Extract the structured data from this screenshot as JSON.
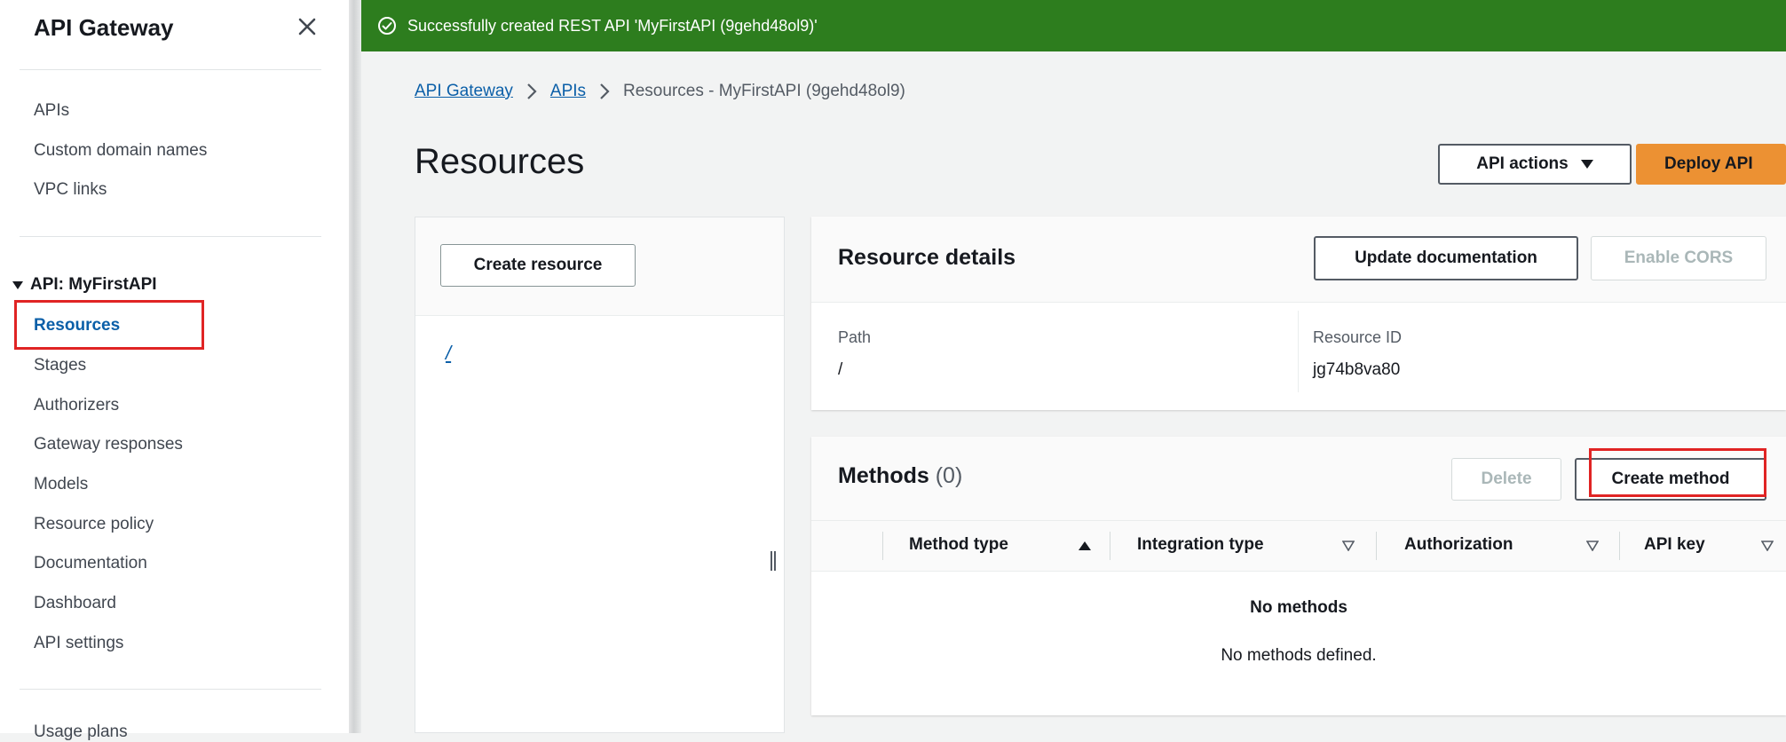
{
  "sidebar": {
    "title": "API Gateway",
    "top_links": [
      "APIs",
      "Custom domain names",
      "VPC links"
    ],
    "group_label": "API: MyFirstAPI",
    "group_items": [
      "Resources",
      "Stages",
      "Authorizers",
      "Gateway responses",
      "Models",
      "Resource policy",
      "Documentation",
      "Dashboard",
      "API settings"
    ],
    "truncated_item": "Usage plans"
  },
  "flash": {
    "message": "Successfully created REST API 'MyFirstAPI (9gehd48ol9)'",
    "color": "#2d7d1e"
  },
  "breadcrumb": {
    "items": [
      "API Gateway",
      "APIs"
    ],
    "current": "Resources - MyFirstAPI (9gehd48ol9)"
  },
  "page": {
    "title": "Resources",
    "api_actions_label": "API actions",
    "deploy_label": "Deploy API",
    "accent_color": "#ec9133"
  },
  "resource_tree": {
    "create_label": "Create resource",
    "root": "/"
  },
  "resource_details": {
    "title": "Resource details",
    "update_doc_label": "Update documentation",
    "enable_cors_label": "Enable CORS",
    "path_label": "Path",
    "path_value": "/",
    "resource_id_label": "Resource ID",
    "resource_id_value": "jg74b8va80"
  },
  "methods": {
    "title": "Methods",
    "count": "(0)",
    "delete_label": "Delete",
    "create_label": "Create method",
    "columns": [
      "Method type",
      "Integration type",
      "Authorization",
      "API key"
    ],
    "empty_title": "No methods",
    "empty_sub": "No methods defined."
  }
}
